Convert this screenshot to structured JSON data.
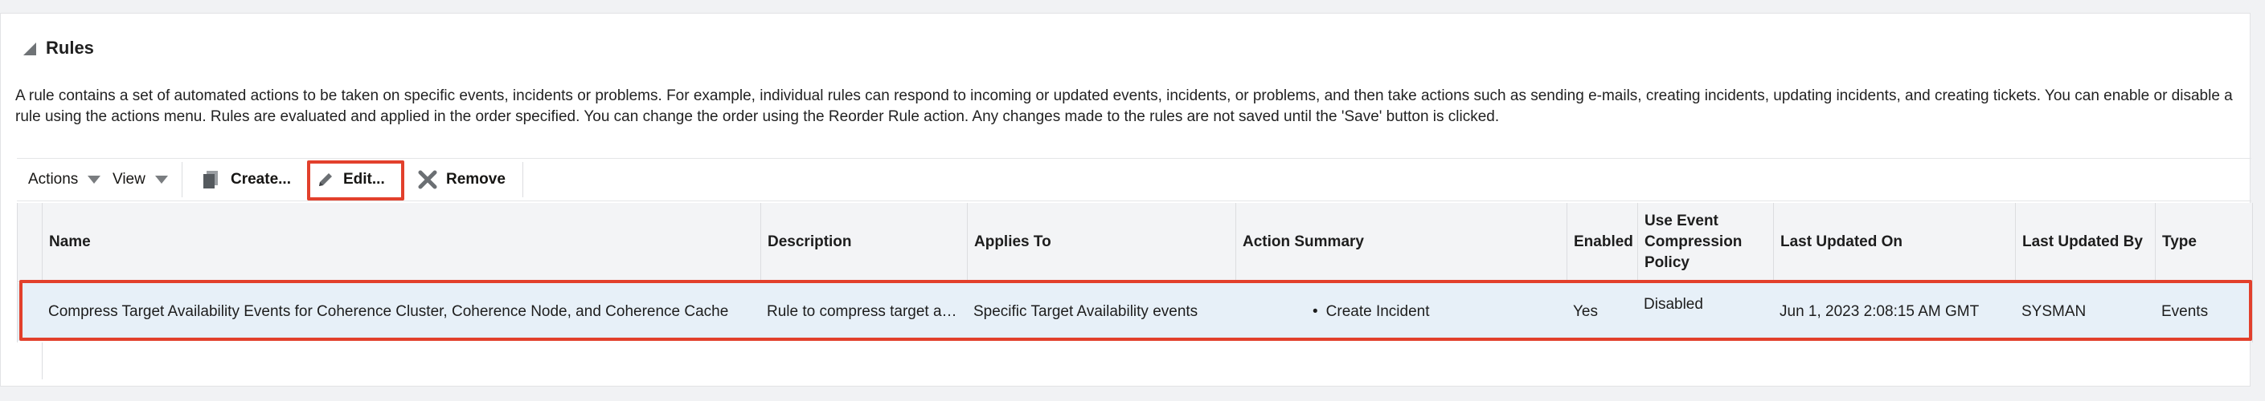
{
  "section": {
    "title": "Rules",
    "description": "A rule contains a set of automated actions to be taken on specific events, incidents or problems. For example, individual rules can respond to incoming or updated events, incidents, or problems, and then take actions such as sending e-mails, creating incidents, updating incidents, and creating tickets. You can enable or disable a rule using the actions menu. Rules are evaluated and applied in the order specified. You can change the order using the Reorder Rule action. Any changes made to the rules are not saved until the 'Save' button is clicked."
  },
  "toolbar": {
    "actions_label": "Actions",
    "view_label": "View",
    "create_label": "Create...",
    "edit_label": "Edit...",
    "remove_label": "Remove"
  },
  "table": {
    "columns": [
      "Name",
      "Description",
      "Applies To",
      "Action Summary",
      "Enabled",
      "Use Event Compression Policy",
      "Last Updated On",
      "Last Updated By",
      "Type"
    ],
    "rows": [
      {
        "name": "Compress Target Availability Events for Coherence Cluster, Coherence Node, and Coherence Cache",
        "description": "Rule to compress target a…",
        "applies_to": "Specific Target Availability events",
        "action_summary": "Create Incident",
        "enabled": "Yes",
        "compression_policy": "Disabled",
        "last_updated_on": "Jun 1, 2023 2:08:15 AM GMT",
        "last_updated_by": "SYSMAN",
        "type": "Events"
      }
    ]
  },
  "colors": {
    "highlight": "#e2402c",
    "selected_row": "#e7f0f8",
    "header_bg": "#f3f4f6"
  },
  "icons": [
    "collapse-triangle-icon",
    "dropdown-caret-icon",
    "create-page-icon",
    "pencil-icon",
    "x-mark-icon"
  ]
}
